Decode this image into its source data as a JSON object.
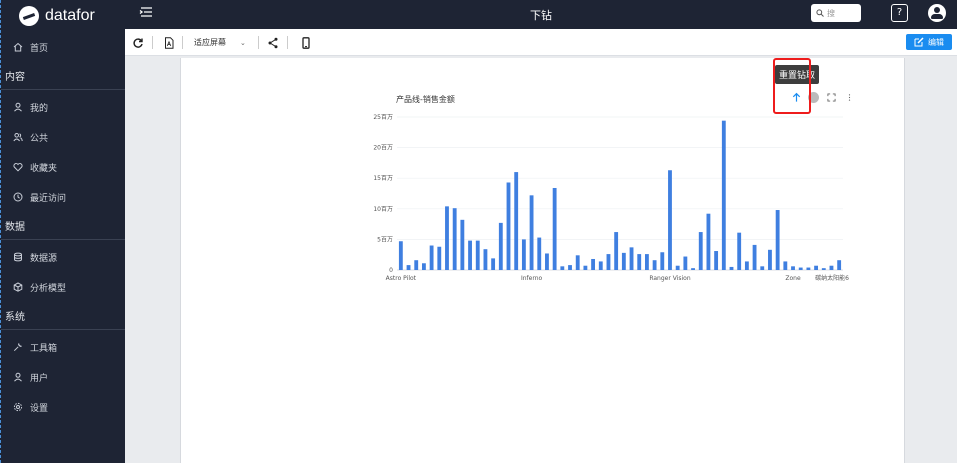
{
  "app": {
    "logo_text": "datafor",
    "page_title": "下钻"
  },
  "sidebar": {
    "home": {
      "label": "首页",
      "icon": "home-icon"
    },
    "groups": [
      {
        "title": "内容",
        "items": [
          {
            "label": "我的",
            "icon": "user-icon"
          },
          {
            "label": "公共",
            "icon": "users-icon"
          },
          {
            "label": "收藏夹",
            "icon": "heart-icon"
          },
          {
            "label": "最近访问",
            "icon": "clock-icon"
          }
        ]
      },
      {
        "title": "数据",
        "items": [
          {
            "label": "数据源",
            "icon": "database-icon"
          },
          {
            "label": "分析模型",
            "icon": "cube-icon"
          }
        ]
      },
      {
        "title": "系统",
        "items": [
          {
            "label": "工具箱",
            "icon": "wrench-icon"
          },
          {
            "label": "用户",
            "icon": "user-icon"
          },
          {
            "label": "设置",
            "icon": "gear-icon"
          }
        ]
      }
    ]
  },
  "topbar": {
    "search_placeholder": "搜",
    "help_label": "?"
  },
  "toolbar": {
    "fit_label": "适应屏幕",
    "edit_label": "编辑"
  },
  "chart": {
    "tooltip": "重置钻取"
  },
  "chart_data": {
    "type": "bar",
    "title": "产品线-销售金额",
    "color": "#3f7fe0",
    "y_ticks": [
      "0",
      "5百万",
      "10百万",
      "15百万",
      "20百万",
      "25百万"
    ],
    "ylim": [
      0,
      25
    ],
    "unit": "百万",
    "x_tick_labels": [
      "Astro Pilot",
      "Inferno",
      "Ranger Vision",
      "Zone",
      "碳纳太阳能6"
    ],
    "values": [
      4.7,
      0.8,
      1.6,
      1.1,
      4.0,
      3.8,
      10.4,
      10.1,
      8.2,
      4.8,
      4.8,
      3.4,
      1.9,
      7.7,
      14.3,
      16.0,
      5.0,
      12.2,
      5.3,
      2.7,
      13.4,
      0.6,
      0.8,
      2.4,
      0.7,
      1.8,
      1.4,
      2.6,
      6.2,
      2.8,
      3.7,
      2.6,
      2.6,
      1.6,
      2.9,
      16.3,
      0.7,
      2.2,
      0.3,
      6.2,
      9.2,
      3.1,
      24.4,
      0.5,
      6.1,
      1.4,
      4.1,
      0.6,
      3.3,
      9.8,
      1.4,
      0.6,
      0.4,
      0.4,
      0.7,
      0.3,
      0.7,
      1.6
    ],
    "x_label_indices": [
      0,
      17,
      35,
      51,
      74
    ]
  }
}
